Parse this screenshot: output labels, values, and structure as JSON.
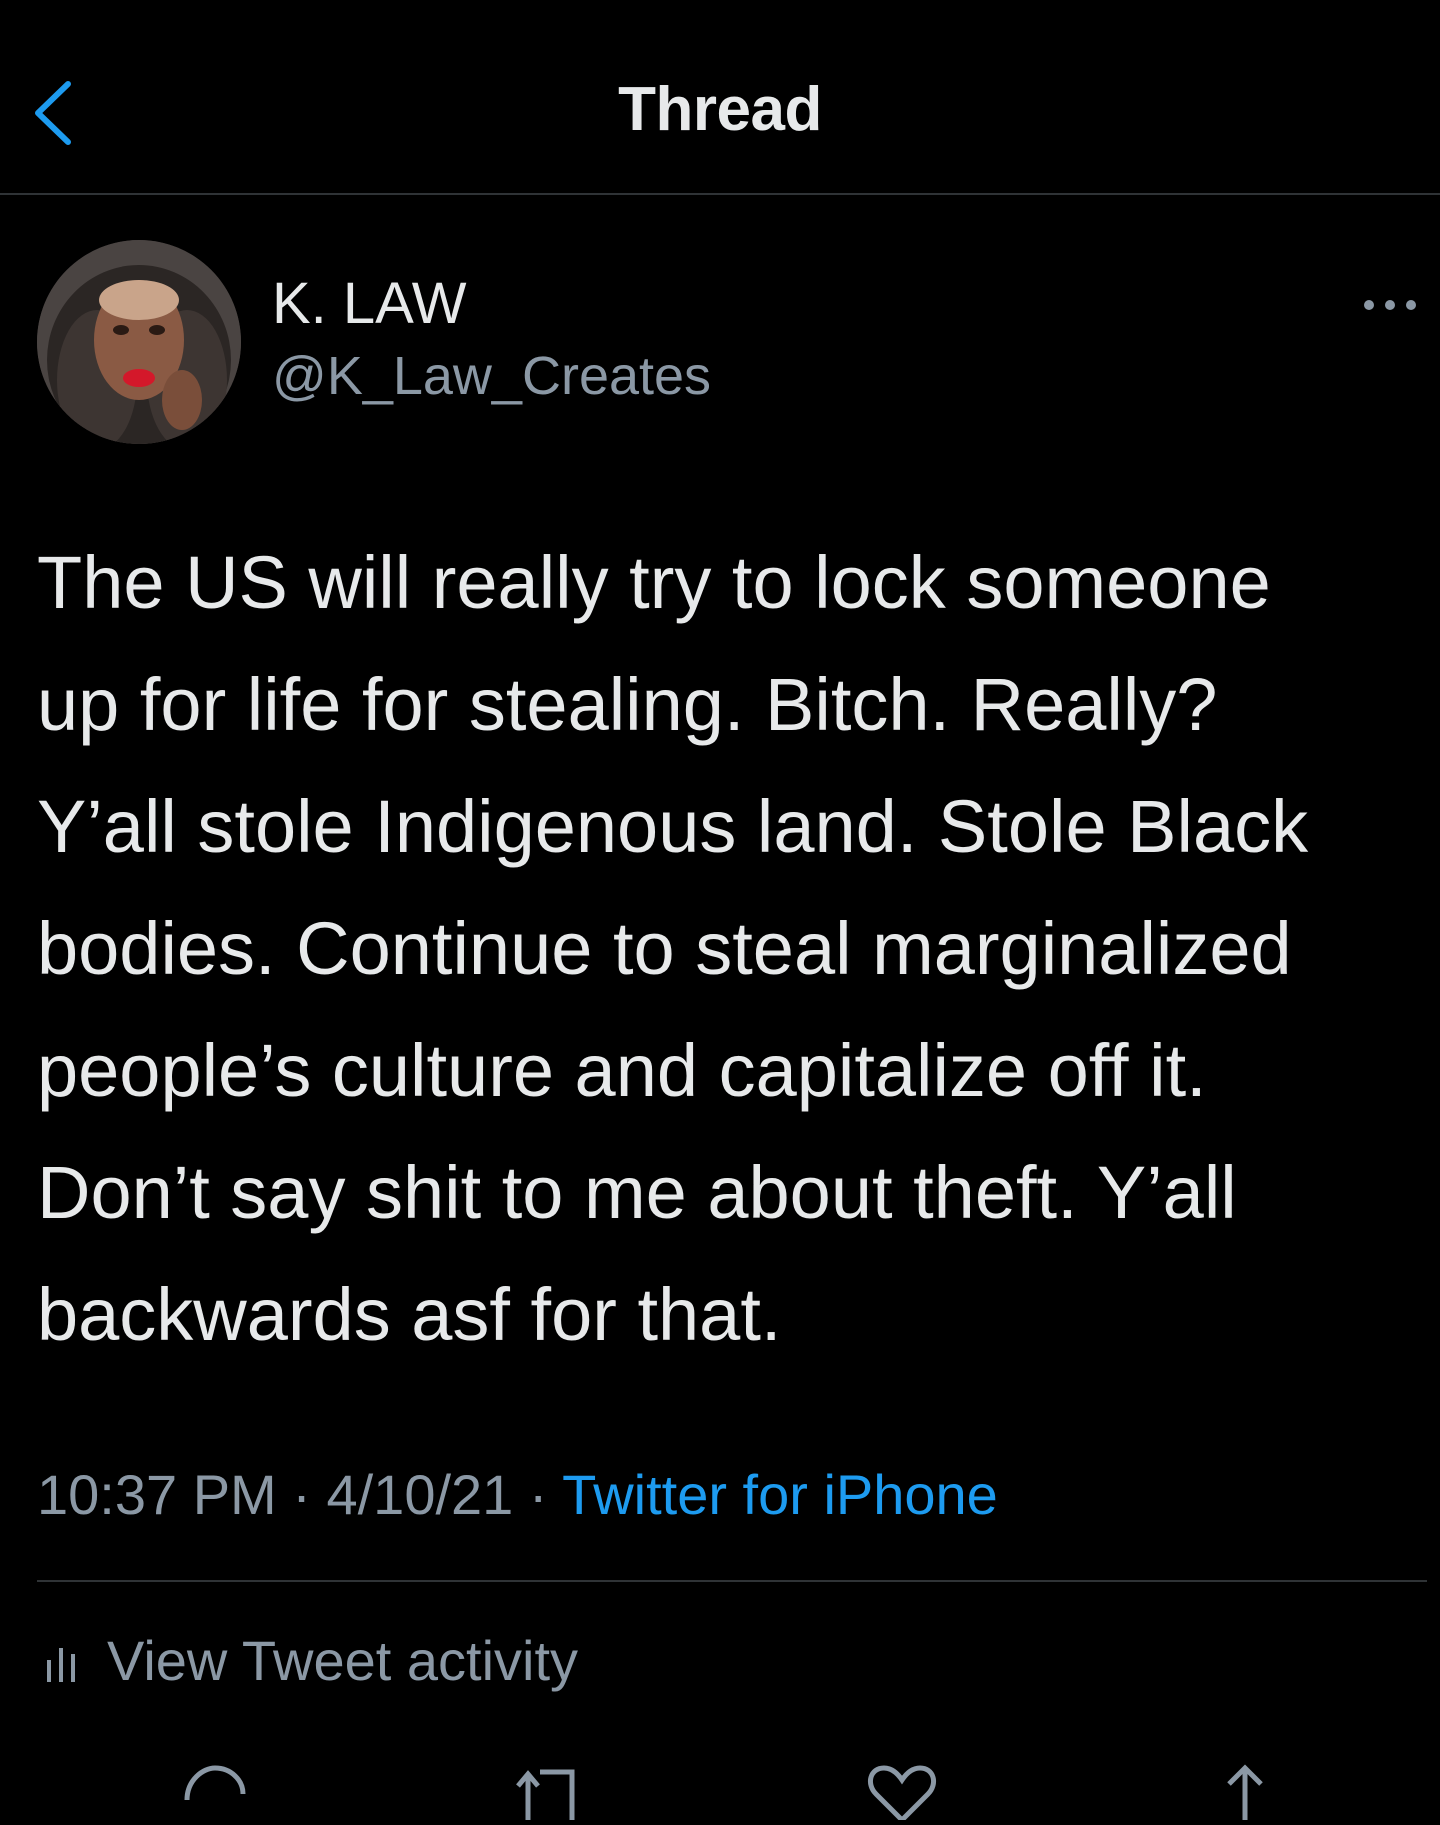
{
  "header": {
    "title": "Thread",
    "back_icon": "chevron-left-icon"
  },
  "tweet": {
    "author": {
      "display_name": "K. LAW",
      "handle": "@K_Law_Creates"
    },
    "text_lines": [
      "The US will really try to lock someone",
      "up for life for stealing. Bitch. Really?",
      "Y’all stole Indigenous land. Stole Black",
      "bodies. Continue to steal marginalized",
      "people’s culture and capitalize off it.",
      "Don’t say shit to me about theft. Y’all",
      "backwards asf for that."
    ],
    "time": "10:37 PM",
    "separator": " · ",
    "date": "4/10/21",
    "source": "Twitter for iPhone"
  },
  "activity": {
    "label": "View Tweet activity",
    "icon": "bar-chart-icon"
  },
  "actions": [
    "reply-icon",
    "retweet-icon",
    "like-icon",
    "share-icon"
  ],
  "colors": {
    "background": "#000000",
    "text": "#e7e9ea",
    "muted": "#8b98a5",
    "accent": "#1d9bf0",
    "divider": "#2f3336"
  }
}
